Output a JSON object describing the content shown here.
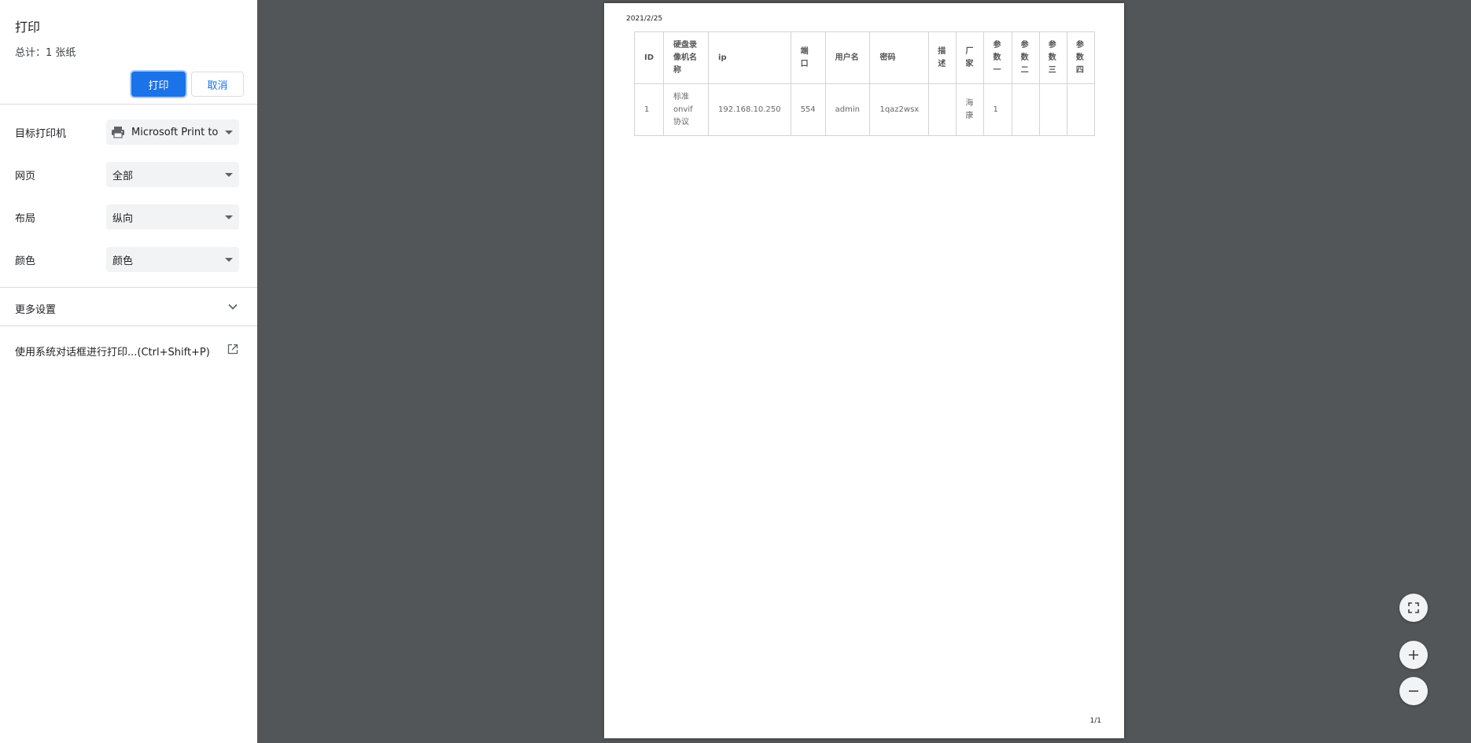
{
  "sidebar": {
    "title": "打印",
    "summary": "总计：1 张纸",
    "print_label": "打印",
    "cancel_label": "取消",
    "settings": [
      {
        "label": "目标打印机",
        "value": "Microsoft Print to",
        "icon": "printer-icon"
      },
      {
        "label": "网页",
        "value": "全部"
      },
      {
        "label": "布局",
        "value": "纵向"
      },
      {
        "label": "颜色",
        "value": "颜色"
      }
    ],
    "more_settings": "更多设置",
    "system_dialog": "使用系统对话框进行打印...(Ctrl+Shift+P)"
  },
  "preview": {
    "date": "2021/2/25",
    "page_number": "1/1",
    "table": {
      "headers": [
        "ID",
        "硬盘录像机名称",
        "ip",
        "端口",
        "用户名",
        "密码",
        "描述",
        "厂家",
        "参数一",
        "参数二",
        "参数三",
        "参数四"
      ],
      "rows": [
        [
          "1",
          "标准onvif协议",
          "192.168.10.250",
          "554",
          "admin",
          "1qaz2wsx",
          "",
          "海康",
          "1",
          "",
          "",
          ""
        ]
      ]
    }
  },
  "colors": {
    "accent": "#1a73e8",
    "viewer_bg": "#525659"
  }
}
